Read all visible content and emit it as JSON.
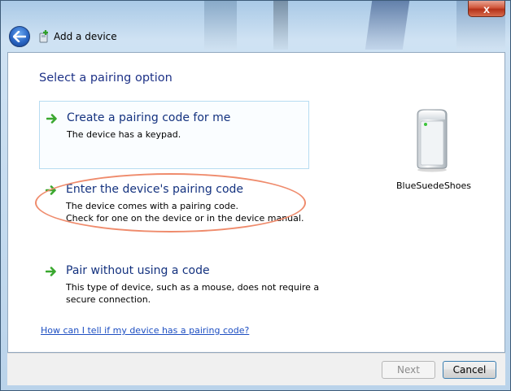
{
  "window": {
    "title": "Add a device",
    "close_glyph": "x"
  },
  "icons": {
    "back": "back-arrow-icon",
    "title": "add-device-icon",
    "option_arrow": "green-arrow-icon",
    "device": "bluetooth-device-icon"
  },
  "content": {
    "heading": "Select a pairing option",
    "options": [
      {
        "title": "Create a pairing code for me",
        "desc": [
          "The device has a keypad."
        ]
      },
      {
        "title": "Enter the device's pairing code",
        "desc": [
          "The device comes with a pairing code.",
          "Check for one on the device or in the device manual."
        ]
      },
      {
        "title": "Pair without using a code",
        "desc": [
          "This type of device, such as a mouse, does not require a",
          "secure connection."
        ]
      }
    ],
    "device_name": "BlueSuedeShoes",
    "help_link": "How can I tell if my device has a pairing code?"
  },
  "footer": {
    "next_label": "Next",
    "cancel_label": "Cancel"
  },
  "colors": {
    "heading": "#1e3287",
    "link": "#1e4fc2",
    "highlight": "#ef8b6c",
    "arrow_green": "#3aa82f"
  }
}
